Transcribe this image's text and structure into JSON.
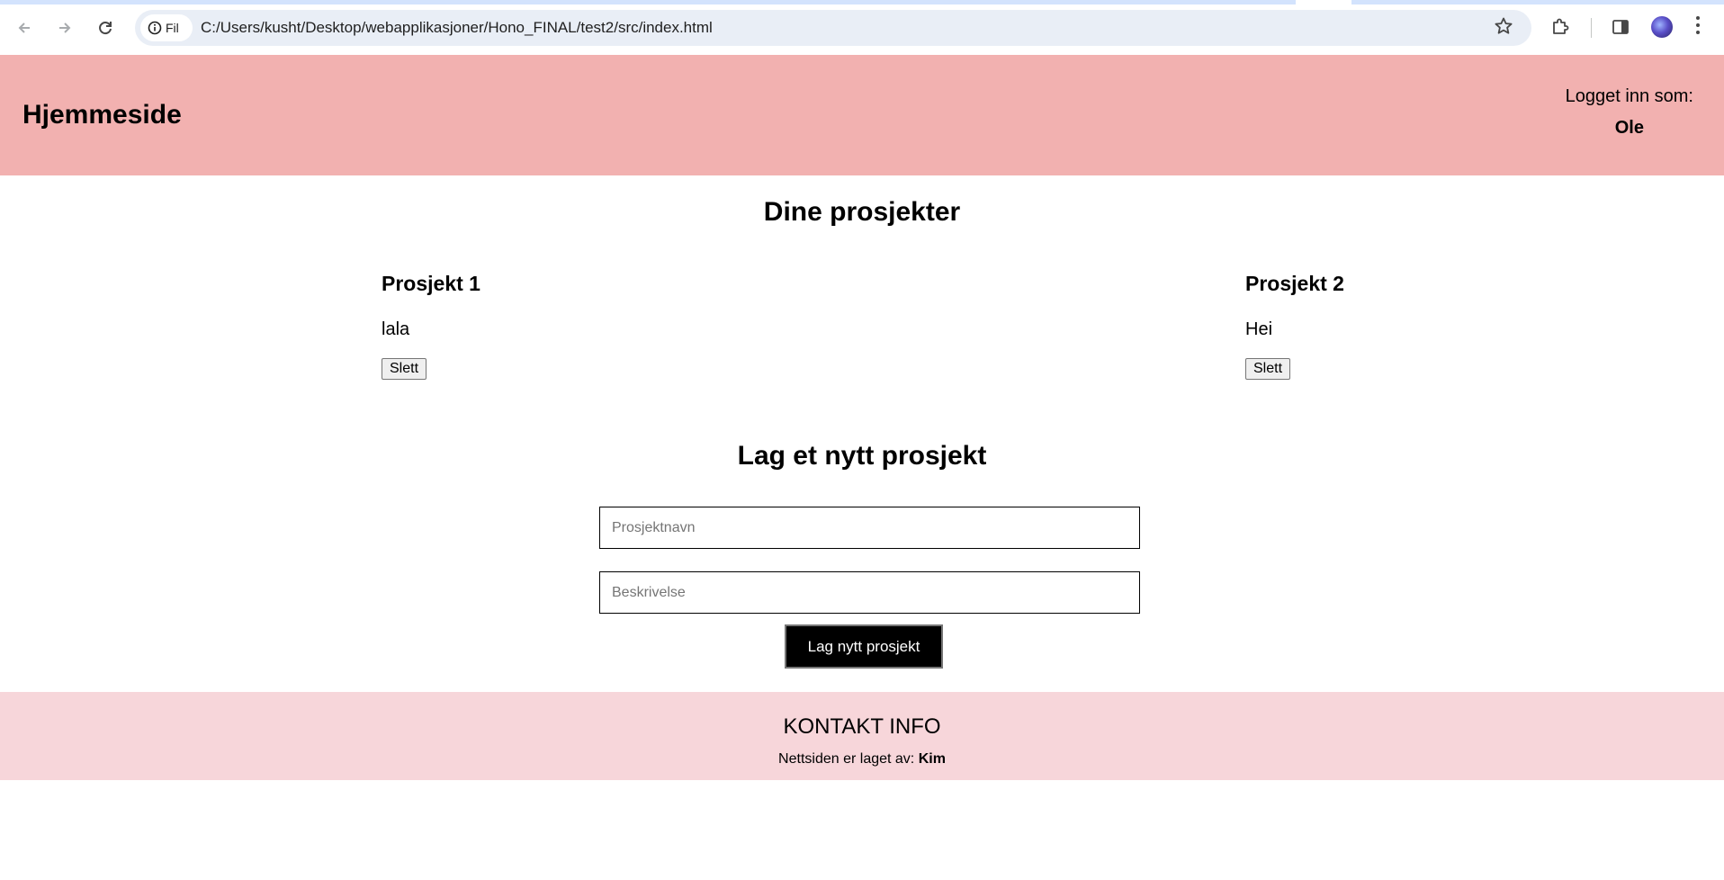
{
  "browser": {
    "site_chip_label": "Fil",
    "url": "C:/Users/kusht/Desktop/webapplikasjoner/Hono_FINAL/test2/src/index.html"
  },
  "header": {
    "title": "Hjemmeside",
    "logged_in_label": "Logget inn som:",
    "username": "Ole"
  },
  "projects": {
    "heading": "Dine prosjekter",
    "items": [
      {
        "name": "Prosjekt 1",
        "description": "lala",
        "delete_label": "Slett"
      },
      {
        "name": "Prosjekt 2",
        "description": "Hei",
        "delete_label": "Slett"
      }
    ]
  },
  "new_project": {
    "heading": "Lag et nytt prosjekt",
    "name_placeholder": "Prosjektnavn",
    "name_value": "",
    "description_placeholder": "Beskrivelse",
    "description_value": "",
    "submit_label": "Lag nytt prosjekt"
  },
  "footer": {
    "contact_heading": "KONTAKT INFO",
    "credit_prefix": "Nettsiden er laget av:",
    "credit_name": "Kim"
  },
  "colors": {
    "header_bg": "#f2b1b0",
    "footer_bg": "#f7d6da",
    "button_bg": "#000000"
  }
}
